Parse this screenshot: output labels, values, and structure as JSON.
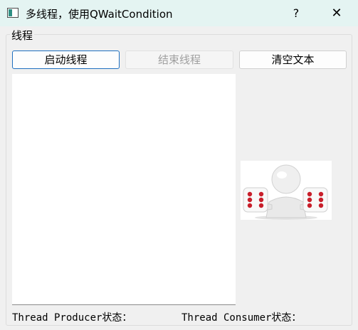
{
  "window": {
    "title": "多线程，使用QWaitCondition",
    "help_glyph": "?",
    "close_glyph": "✕"
  },
  "groupbox": {
    "title": "线程"
  },
  "buttons": {
    "start": "启动线程",
    "stop": "结束线程",
    "clear": "清空文本"
  },
  "log": {
    "text": ""
  },
  "image": {
    "icon": "dice-figure-image"
  },
  "status": {
    "producer": "Thread Producer状态：",
    "consumer": "Thread Consumer状态："
  }
}
